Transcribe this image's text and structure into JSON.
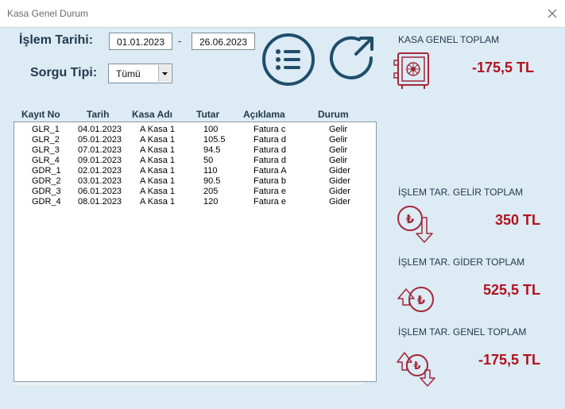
{
  "window": {
    "title": "Kasa Genel Durum"
  },
  "filters": {
    "date_label": "İşlem Tarihi:",
    "date_from": "01.01.2023",
    "date_separator": "-",
    "date_to": "26.06.2023",
    "type_label": "Sorgu Tipi:",
    "type_value": "Tümü"
  },
  "table": {
    "columns": [
      "Kayıt No",
      "Tarih",
      "Kasa Adı",
      "Tutar",
      "Açıklama",
      "Durum"
    ],
    "rows": [
      [
        "GLR_1",
        "04.01.2023",
        "A Kasa 1",
        "100",
        "Fatura c",
        "Gelir"
      ],
      [
        "GLR_2",
        "05.01.2023",
        "A Kasa 1",
        "105.5",
        "Fatura d",
        "Gelir"
      ],
      [
        "GLR_3",
        "07.01.2023",
        "A Kasa 1",
        "94.5",
        "Fatura d",
        "Gelir"
      ],
      [
        "GLR_4",
        "09.01.2023",
        "A Kasa 1",
        "50",
        "Fatura d",
        "Gelir"
      ],
      [
        "GDR_1",
        "02.01.2023",
        "A Kasa 1",
        "110",
        "Fatura A",
        "Gider"
      ],
      [
        "GDR_2",
        "03.01.2023",
        "A Kasa 1",
        "90.5",
        "Fatura b",
        "Gider"
      ],
      [
        "GDR_3",
        "06.01.2023",
        "A Kasa 1",
        "205",
        "Fatura e",
        "Gider"
      ],
      [
        "GDR_4",
        "08.01.2023",
        "A Kasa 1",
        "120",
        "Fatura e",
        "Gider"
      ]
    ]
  },
  "summary": {
    "kasa_genel_label": "KASA GENEL TOPLAM",
    "kasa_genel_value": "-175,5 TL",
    "gelir_label": "İŞLEM TAR. GELİR TOPLAM",
    "gelir_value": "350 TL",
    "gider_label": "İŞLEM TAR. GİDER TOPLAM",
    "gider_value": "525,5 TL",
    "islem_genel_label": "İŞLEM TAR. GENEL TOPLAM",
    "islem_genel_value": "-175,5 TL"
  },
  "colors": {
    "accent_dark": "#1f4e6b",
    "value_red": "#b2121f",
    "icon_red": "#a2283a",
    "background": "#dcebf4"
  },
  "icons": [
    "close-icon",
    "list-icon",
    "refresh-icon",
    "safe-icon",
    "lira-down-icon",
    "lira-up-icon",
    "lira-updown-icon"
  ]
}
